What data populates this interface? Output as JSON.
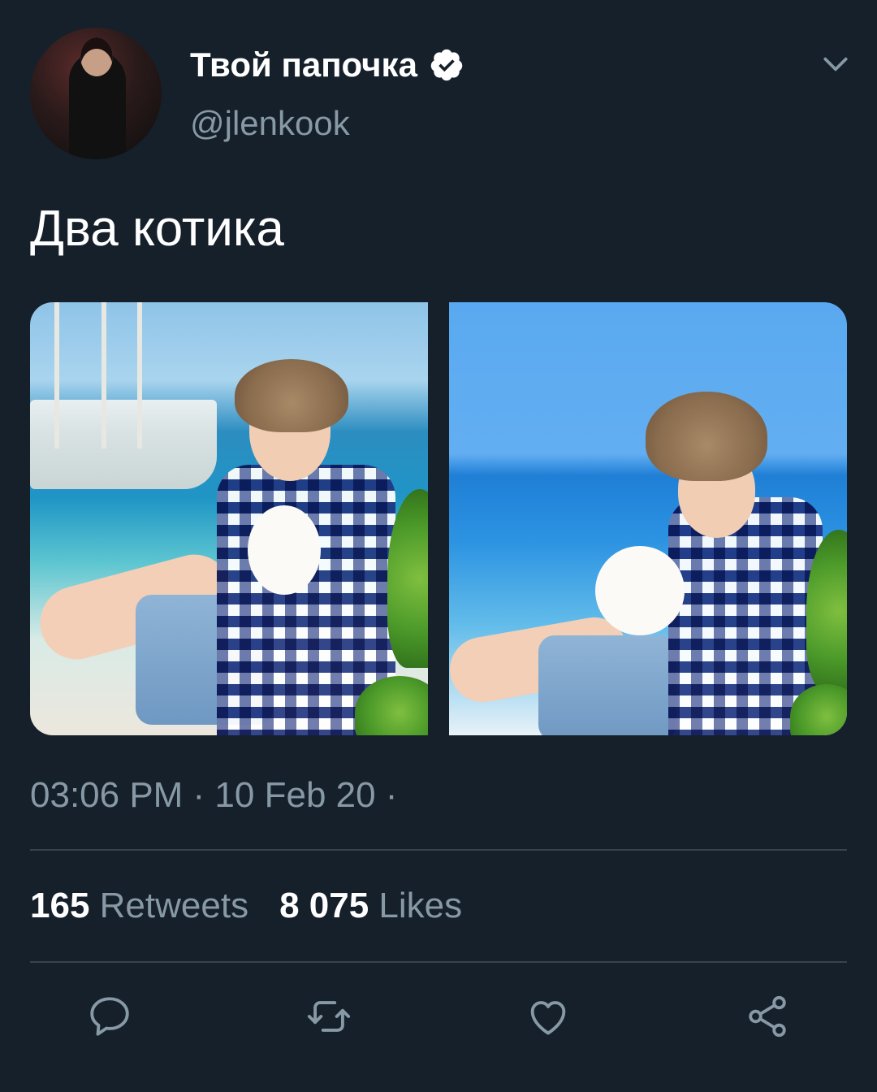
{
  "user": {
    "display_name": "Твой папочка",
    "handle": "@jlenkook",
    "verified": true
  },
  "tweet": {
    "text": "Два котика",
    "timestamp": "03:06 PM · 10 Feb 20 ·"
  },
  "stats": {
    "retweets_count": "165",
    "retweets_label": "Retweets",
    "likes_count": "8 075",
    "likes_label": "Likes"
  },
  "icons": {
    "verified": "verified-badge-icon",
    "menu": "chevron-down-icon",
    "reply": "comment-icon",
    "retweet": "retweet-icon",
    "like": "heart-icon",
    "share": "share-icon"
  },
  "colors": {
    "background": "#15202b",
    "text_primary": "#ffffff",
    "text_secondary": "#8899a6",
    "divider": "#38444d"
  }
}
